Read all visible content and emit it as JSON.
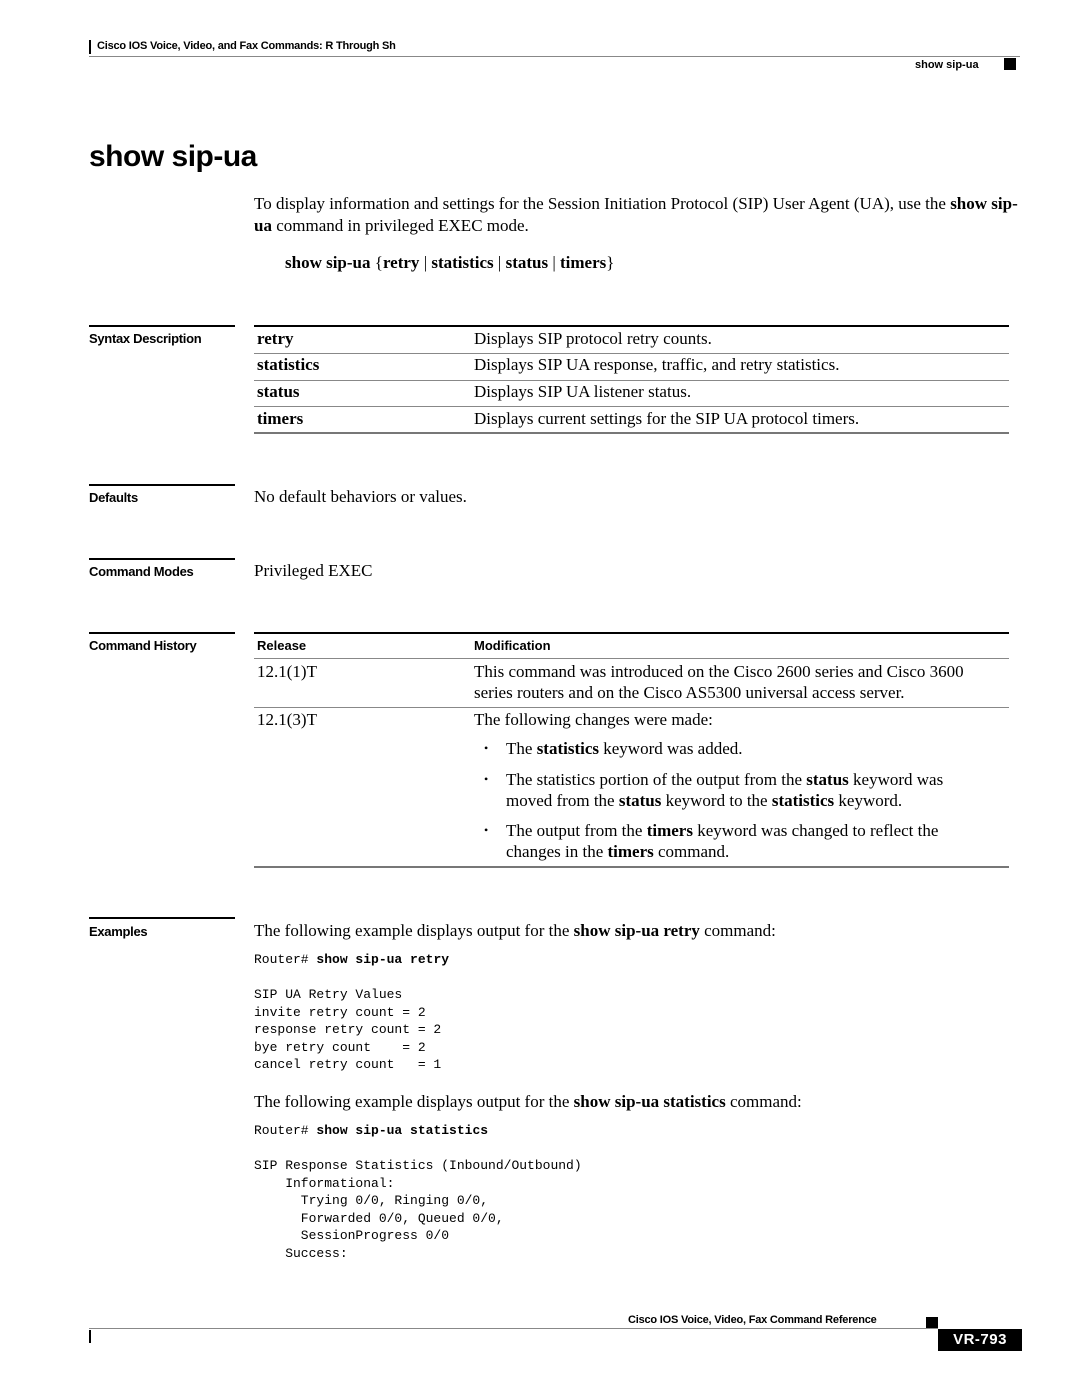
{
  "header": {
    "book_title": "Cisco IOS Voice, Video, and Fax Commands: R Through Sh",
    "command_label": "show sip-ua"
  },
  "title": "show sip-ua",
  "intro": {
    "text_before": "To display information and settings for the Session Initiation Protocol (SIP) User Agent (UA), use the ",
    "bold_cmd": "show sip-ua",
    "text_after": " command in privileged EXEC mode."
  },
  "syntax": {
    "cmd": "show sip-ua",
    "open_brace": " {",
    "kw1": "retry",
    "sep": " | ",
    "kw2": "statistics",
    "kw3": "status",
    "kw4": "timers",
    "close_brace": "}"
  },
  "syntax_description": {
    "label": "Syntax Description",
    "rows": [
      {
        "keyword": "retry",
        "description": "Displays SIP protocol retry counts."
      },
      {
        "keyword": "statistics",
        "description": "Displays SIP UA response, traffic, and retry statistics."
      },
      {
        "keyword": "status",
        "description": "Displays SIP UA listener status."
      },
      {
        "keyword": "timers",
        "description": "Displays current settings for the SIP UA protocol timers."
      }
    ]
  },
  "defaults": {
    "label": "Defaults",
    "text": "No default behaviors or values."
  },
  "command_modes": {
    "label": "Command Modes",
    "text": "Privileged EXEC"
  },
  "command_history": {
    "label": "Command History",
    "headers": {
      "release": "Release",
      "modification": "Modification"
    },
    "rows": [
      {
        "release": "12.1(1)T",
        "line1": "This command was introduced on the Cisco 2600 series and Cisco 3600",
        "line2": "series routers and on the Cisco AS5300 universal access server."
      },
      {
        "release": "12.1(3)T",
        "intro": "The following changes were made:",
        "bullets": [
          {
            "parts": [
              "The ",
              "statistics",
              " keyword was added."
            ]
          },
          {
            "parts": [
              "The statistics portion of the output from the ",
              "status",
              " keyword was"
            ],
            "parts2": [
              "moved from the ",
              "status",
              " keyword to the ",
              "statistics",
              " keyword."
            ]
          },
          {
            "parts": [
              "The output from the ",
              "timers",
              " keyword was changed to reflect the"
            ],
            "parts2": [
              "changes in the ",
              "timers",
              " command."
            ]
          }
        ]
      }
    ]
  },
  "examples": {
    "label": "Examples",
    "ex1": {
      "intro_before": "The following example displays output for the ",
      "intro_bold": "show sip-ua retry",
      "intro_after": " command:",
      "prompt": "Router# ",
      "command": "show sip-ua retry",
      "output": "SIP UA Retry Values\ninvite retry count = 2\nresponse retry count = 2\nbye retry count    = 2\ncancel retry count   = 1"
    },
    "ex2": {
      "intro_before": "The following example displays output for the ",
      "intro_bold": "show sip-ua statistics",
      "intro_after": " command:",
      "prompt": "Router# ",
      "command": "show sip-ua statistics",
      "output": "SIP Response Statistics (Inbound/Outbound)\n    Informational:\n      Trying 0/0, Ringing 0/0,\n      Forwarded 0/0, Queued 0/0,\n      SessionProgress 0/0\n    Success:"
    }
  },
  "footer": {
    "book_title": "Cisco IOS Voice, Video, Fax Command Reference",
    "page_number": "VR-793"
  }
}
